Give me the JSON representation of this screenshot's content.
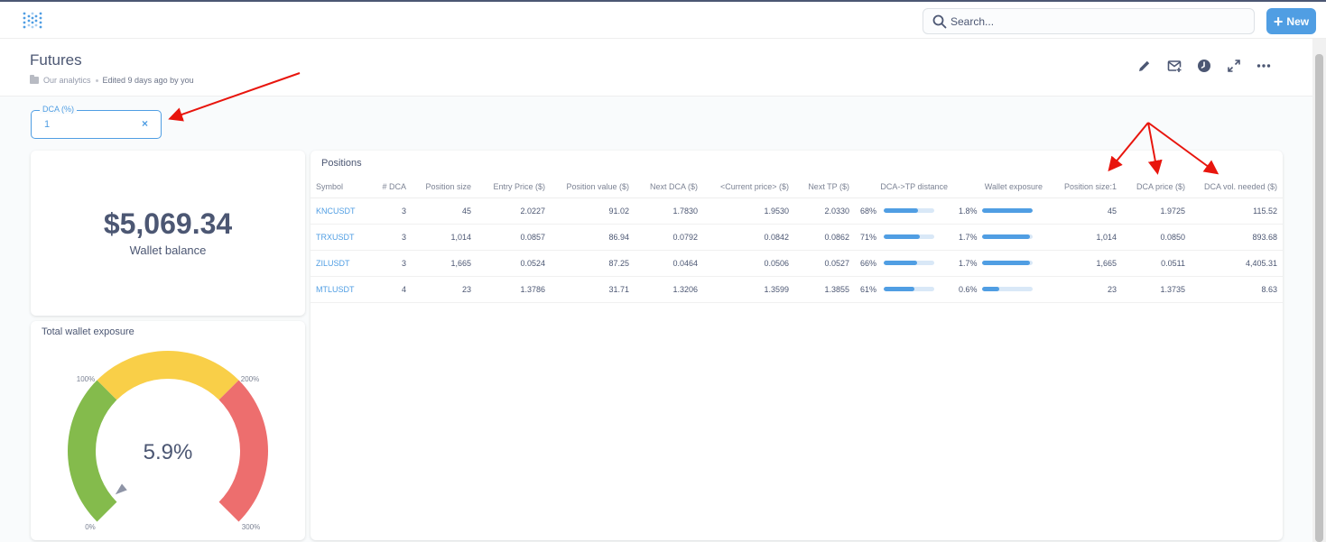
{
  "search": {
    "placeholder": "Search..."
  },
  "new_button": {
    "label": "New"
  },
  "page": {
    "title": "Futures",
    "collection": "Our analytics",
    "edited": "Edited 9 days ago by you"
  },
  "filter": {
    "label": "DCA (%)",
    "value": "1",
    "clear": "×"
  },
  "balance": {
    "value": "$5,069.34",
    "label": "Wallet balance"
  },
  "gauge": {
    "title": "Total wallet exposure",
    "value_label": "5.9%",
    "value": 5.9,
    "min": 0,
    "max": 300,
    "labels": {
      "min": "0%",
      "t1": "100%",
      "t2": "200%",
      "max": "300%"
    },
    "segments": [
      {
        "from": 0,
        "to": 100,
        "color": "#84bb4c"
      },
      {
        "from": 100,
        "to": 200,
        "color": "#f9cf48"
      },
      {
        "from": 200,
        "to": 300,
        "color": "#ed6e6e"
      }
    ]
  },
  "positions": {
    "title": "Positions",
    "columns": [
      "Symbol",
      "# DCA",
      "Position size",
      "Entry Price ($)",
      "Position value ($)",
      "Next DCA ($)",
      "<Current price> ($)",
      "Next TP ($)",
      "DCA->TP distance",
      "Wallet exposure",
      "Position size:1",
      "DCA price ($)",
      "DCA vol. needed ($)"
    ],
    "rows": [
      {
        "symbol": "KNCUSDT",
        "dca": "3",
        "size": "45",
        "entry": "2.0227",
        "value": "91.02",
        "next_dca": "1.7830",
        "current": "1.9530",
        "next_tp": "2.0330",
        "distance": "68%",
        "distance_frac": 0.68,
        "exposure": "1.8%",
        "exposure_frac": 1.0,
        "size1": "45",
        "dca_price": "1.9725",
        "dca_vol": "115.52"
      },
      {
        "symbol": "TRXUSDT",
        "dca": "3",
        "size": "1,014",
        "entry": "0.0857",
        "value": "86.94",
        "next_dca": "0.0792",
        "current": "0.0842",
        "next_tp": "0.0862",
        "distance": "71%",
        "distance_frac": 0.71,
        "exposure": "1.7%",
        "exposure_frac": 0.944,
        "size1": "1,014",
        "dca_price": "0.0850",
        "dca_vol": "893.68"
      },
      {
        "symbol": "ZILUSDT",
        "dca": "3",
        "size": "1,665",
        "entry": "0.0524",
        "value": "87.25",
        "next_dca": "0.0464",
        "current": "0.0506",
        "next_tp": "0.0527",
        "distance": "66%",
        "distance_frac": 0.66,
        "exposure": "1.7%",
        "exposure_frac": 0.944,
        "size1": "1,665",
        "dca_price": "0.0511",
        "dca_vol": "4,405.31"
      },
      {
        "symbol": "MTLUSDT",
        "dca": "4",
        "size": "23",
        "entry": "1.3786",
        "value": "31.71",
        "next_dca": "1.3206",
        "current": "1.3599",
        "next_tp": "1.3855",
        "distance": "61%",
        "distance_frac": 0.61,
        "exposure": "0.6%",
        "exposure_frac": 0.333,
        "size1": "23",
        "dca_price": "1.3735",
        "dca_vol": "8.63"
      }
    ]
  },
  "colors": {
    "accent": "#509ee3",
    "text": "#4c5773",
    "annotation_arrow": "#e8150d"
  },
  "icons": [
    "logo-icon",
    "search-icon",
    "plus-icon",
    "pencil-icon",
    "subscribe-icon",
    "history-icon",
    "fullscreen-icon",
    "more-icon",
    "folder-icon"
  ]
}
